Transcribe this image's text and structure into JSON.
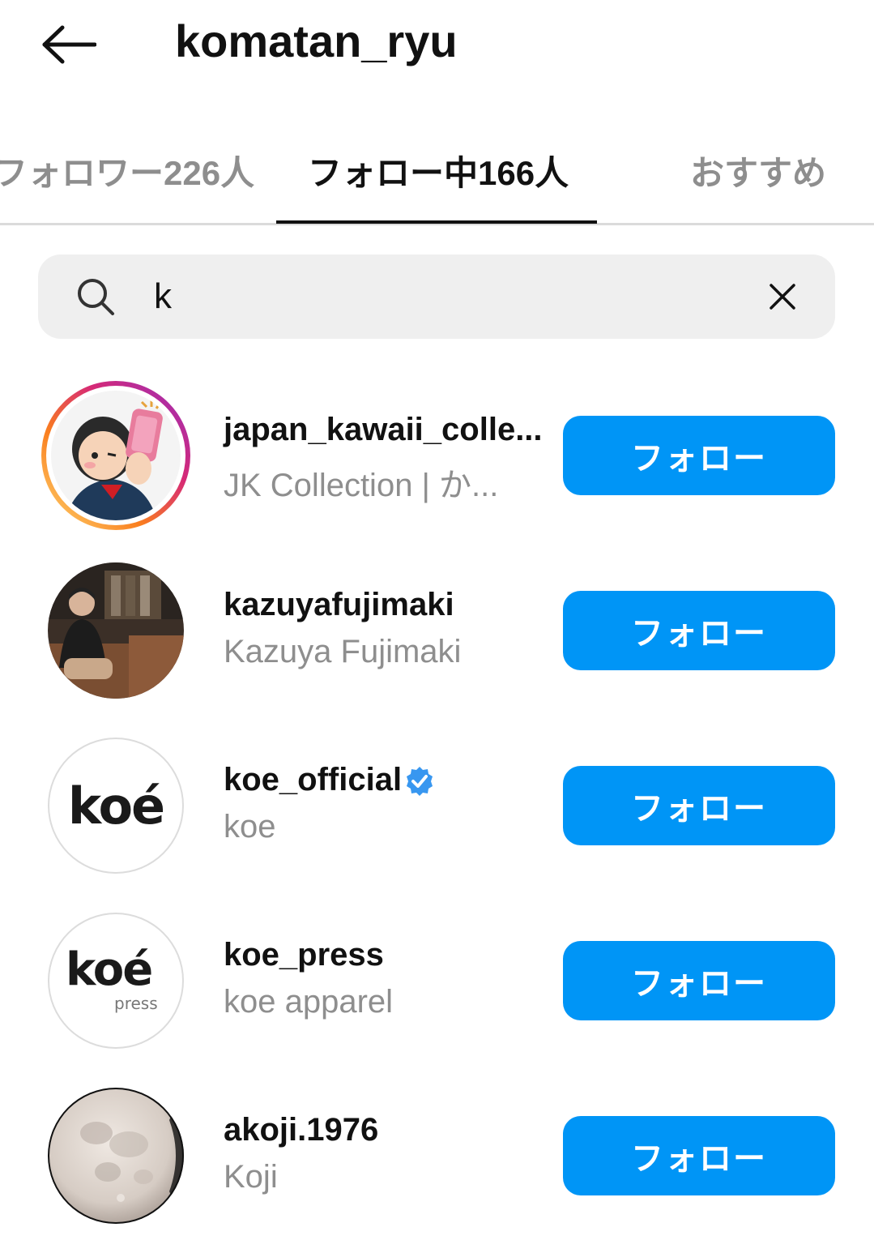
{
  "header": {
    "title": "komatan_ryu"
  },
  "tabs": [
    {
      "label": "フォロワー226人"
    },
    {
      "label": "フォロー中166人"
    },
    {
      "label": "おすすめ"
    }
  ],
  "search": {
    "value": "k"
  },
  "follow_label": "フォロー",
  "accounts": [
    {
      "username": "japan_kawaii_colle...",
      "fullname": "JK Collection | か..."
    },
    {
      "username": "kazuyafujimaki",
      "fullname": "Kazuya Fujimaki"
    },
    {
      "username": "koe_official",
      "fullname": "koe",
      "verified": true
    },
    {
      "username": "koe_press",
      "fullname": "koe apparel"
    },
    {
      "username": "akoji.1976",
      "fullname": "Koji"
    }
  ],
  "logos": {
    "koe": "koé",
    "koe_press_sub": "press"
  },
  "colors": {
    "primary_button": "#0095f6",
    "muted_text": "#8e8e8e",
    "search_bg": "#efefef"
  }
}
